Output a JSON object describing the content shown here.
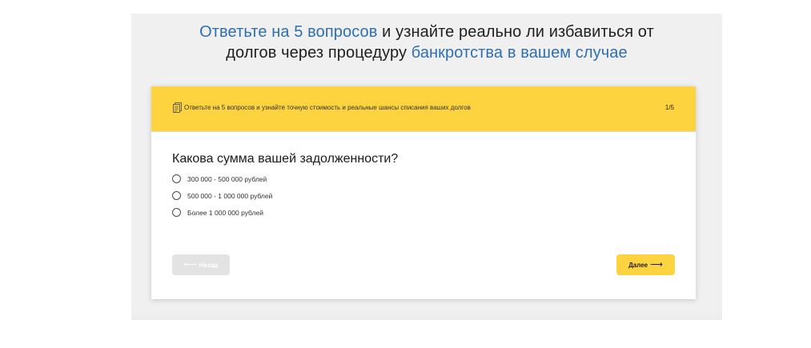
{
  "headline": {
    "line1_accent": "Ответьте на 5 вопросов",
    "line1_rest": " и узнайте реально ли избавиться от",
    "line2_start": "долгов через процедуру ",
    "line2_accent": "банкротства в вашем случае"
  },
  "quiz": {
    "header_icon": "document-icon",
    "header_text": "Ответьте на 5 вопросов и узнайте точную стоимость и реальные шансы списания ваших долгов",
    "step": "1/5",
    "question": "Какова сумма вашей задолженности?",
    "options": [
      {
        "label": "300 000 - 500 000 рублей"
      },
      {
        "label": "500 000 - 1 000 000 рублей"
      },
      {
        "label": "Более 1 000 000 рублей"
      }
    ],
    "back_label": "Назад",
    "next_label": "Далее",
    "back_arrow": "⟵",
    "next_arrow": "⟶"
  },
  "colors": {
    "accent_blue": "#2f6fb0",
    "brand_yellow": "#fdd33f",
    "panel_bg": "#f0f0f0",
    "disabled_button": "#e3e3e3"
  }
}
